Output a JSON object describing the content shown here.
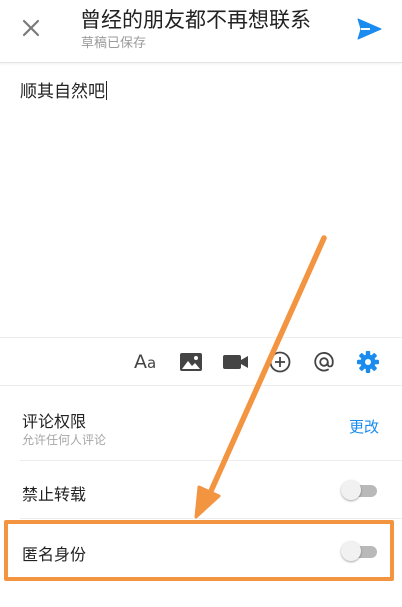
{
  "header": {
    "title": "曾经的朋友都不再想联系",
    "subtitle": "草稿已保存",
    "close_icon": "close-icon",
    "send_icon": "send-icon"
  },
  "editor": {
    "content": "顺其自然吧"
  },
  "toolbar": {
    "font_label_big": "A",
    "font_label_small": "a",
    "items": [
      "font-format-icon",
      "image-icon",
      "video-icon",
      "add-circle-icon",
      "at-icon",
      "settings-gear-icon"
    ]
  },
  "settings": {
    "comment_permission": {
      "label": "评论权限",
      "sub": "允许任何人评论",
      "action": "更改"
    },
    "no_repost": {
      "label": "禁止转载",
      "enabled": false
    },
    "anonymous": {
      "label": "匿名身份",
      "enabled": false
    }
  },
  "colors": {
    "accent": "#1a8cf0",
    "annotation": "#f39440",
    "toggle_track": "#b9b9b9"
  }
}
